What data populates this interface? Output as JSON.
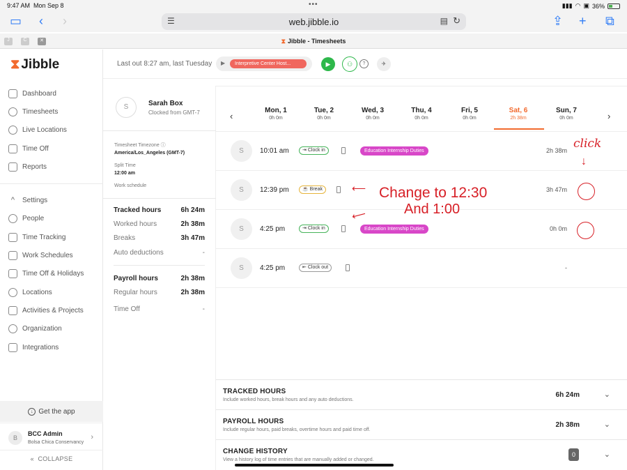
{
  "statusbar": {
    "time": "9:47 AM",
    "date": "Mon Sep 8",
    "battery": "36%"
  },
  "browser": {
    "url": "web.jibble.io",
    "tab_title": "Jibble - Timesheets"
  },
  "sidebar": {
    "brand": "Jibble",
    "items": [
      {
        "label": "Dashboard",
        "icon": "dashboard-icon"
      },
      {
        "label": "Timesheets",
        "icon": "clock-icon"
      },
      {
        "label": "Live Locations",
        "icon": "location-pin-icon"
      },
      {
        "label": "Time Off",
        "icon": "time-off-icon"
      },
      {
        "label": "Reports",
        "icon": "reports-icon"
      }
    ],
    "settings_items": [
      {
        "label": "Settings",
        "icon": "chevron-up-icon"
      },
      {
        "label": "People",
        "icon": "people-icon"
      },
      {
        "label": "Time Tracking",
        "icon": "time-tracking-icon"
      },
      {
        "label": "Work Schedules",
        "icon": "schedule-icon"
      },
      {
        "label": "Time Off & Holidays",
        "icon": "holidays-icon"
      },
      {
        "label": "Locations",
        "icon": "location-pin-icon"
      },
      {
        "label": "Activities & Projects",
        "icon": "tag-icon"
      },
      {
        "label": "Organization",
        "icon": "gear-icon"
      },
      {
        "label": "Integrations",
        "icon": "integrations-icon"
      }
    ],
    "get_app": "Get the app",
    "admin": {
      "initial": "B",
      "name": "BCC Admin",
      "org": "Bolsa Chica Conservancy"
    },
    "collapse": "COLLAPSE"
  },
  "header": {
    "last_out": "Last out 8:27 am, last Tuesday",
    "activity": "Interpretive Center Host..."
  },
  "employee": {
    "initial": "S",
    "name": "Sarah Box",
    "clocked_from": "Clocked from GMT-7",
    "tz_label": "Timesheet Timezone",
    "tz_value": "America/Los_Angeles (GMT-7)",
    "split_label": "Split Time",
    "split_value": "12:00 am",
    "schedule_label": "Work schedule",
    "stats": [
      {
        "label": "Tracked hours",
        "value": "6h 24m"
      },
      {
        "label": "Worked hours",
        "value": "2h 38m"
      },
      {
        "label": "Breaks",
        "value": "3h 47m"
      },
      {
        "label": "Auto deductions",
        "value": "-"
      },
      {
        "label": "Payroll hours",
        "value": "2h 38m"
      },
      {
        "label": "Regular hours",
        "value": "2h 38m"
      },
      {
        "label": "Time Off",
        "value": "-"
      }
    ]
  },
  "week": [
    {
      "day": "Mon, 1",
      "hours": "0h 0m"
    },
    {
      "day": "Tue, 2",
      "hours": "0h 0m"
    },
    {
      "day": "Wed, 3",
      "hours": "0h 0m"
    },
    {
      "day": "Thu, 4",
      "hours": "0h 0m"
    },
    {
      "day": "Fri, 5",
      "hours": "0h 0m"
    },
    {
      "day": "Sat, 6",
      "hours": "2h 38m",
      "active": true
    },
    {
      "day": "Sun, 7",
      "hours": "0h 0m"
    }
  ],
  "entries": [
    {
      "initial": "S",
      "time": "10:01 am",
      "type": "Clock in",
      "activity": "Education Internship Duties",
      "duration": "2h 38m"
    },
    {
      "initial": "S",
      "time": "12:39 pm",
      "type": "Break",
      "activity": "",
      "duration": "3h 47m"
    },
    {
      "initial": "S",
      "time": "4:25 pm",
      "type": "Clock in",
      "activity": "Education Internship Duties",
      "duration": "0h 0m"
    },
    {
      "initial": "S",
      "time": "4:25 pm",
      "type": "Clock out",
      "activity": "",
      "duration": "-"
    }
  ],
  "annotations": {
    "click": "click",
    "line1": "Change to 12:30",
    "line2": "And 1:00",
    "color": "#d71f26"
  },
  "summary": [
    {
      "title": "TRACKED HOURS",
      "sub": "Include worked hours, break hours and any auto deductions.",
      "value": "6h 24m"
    },
    {
      "title": "PAYROLL HOURS",
      "sub": "Include regular hours, paid breaks, overtime hours and paid time off.",
      "value": "2h 38m"
    },
    {
      "title": "CHANGE HISTORY",
      "sub": "View a history log of time entries that are manually added or changed.",
      "value": "0"
    }
  ],
  "colors": {
    "accent": "#f26a2e",
    "green": "#2eb84b",
    "activity_pink": "#d847c8",
    "annotation_red": "#d71f26"
  }
}
